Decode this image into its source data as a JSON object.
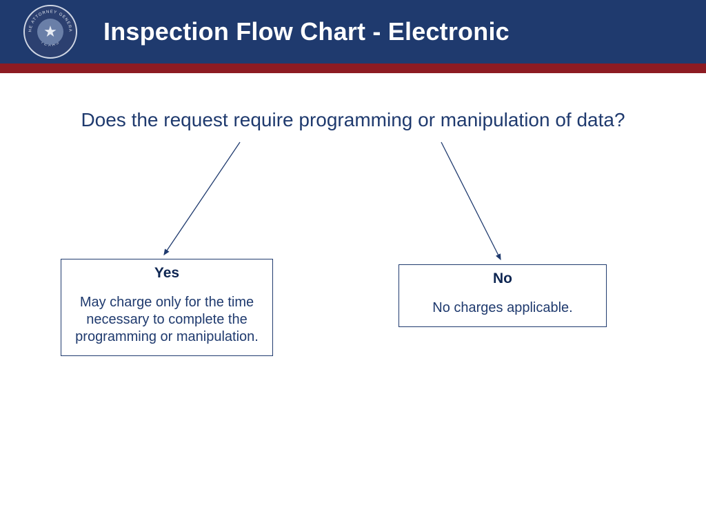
{
  "header": {
    "title": "Inspection Flow Chart - Electronic",
    "seal_top_text": "THE ATTORNEY GENERAL",
    "seal_bottom_text": "TEXAS"
  },
  "question": "Does the request require programming or manipulation of data?",
  "yes_box": {
    "title": "Yes",
    "body": "May charge only for the time necessary to complete the programming or manipulation."
  },
  "no_box": {
    "title": "No",
    "body": "No charges applicable."
  },
  "colors": {
    "header_bg": "#1f3a6e",
    "accent_bar": "#8d1b22",
    "text_primary": "#1f3a6e",
    "text_dark": "#0e2652"
  }
}
